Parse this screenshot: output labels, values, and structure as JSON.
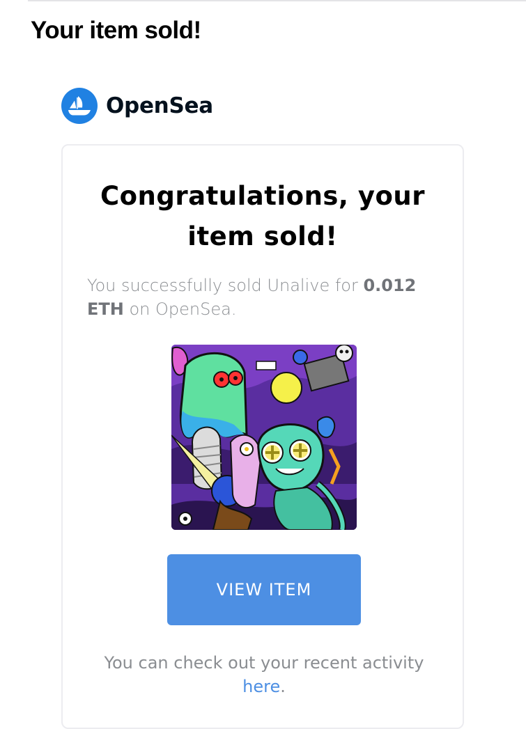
{
  "email": {
    "subject": "Your item sold!"
  },
  "brand": {
    "name": "OpenSea",
    "logo_icon": "opensea-boat-icon",
    "color": "#2081e2"
  },
  "card": {
    "headline_line1": "Congratulations, your",
    "headline_line2": "item sold!",
    "message": {
      "prefix": "You successfully sold Unalive for ",
      "price": "0.012",
      "currency": "ETH",
      "suffix": " on OpenSea."
    },
    "nft_image_icon": "nft-artwork-image",
    "view_button_label": "VIEW ITEM",
    "footer_text": "You can check out your recent activity",
    "footer_link_label": "here",
    "footer_period": ".",
    "accent_color": "#4d8fe3"
  }
}
